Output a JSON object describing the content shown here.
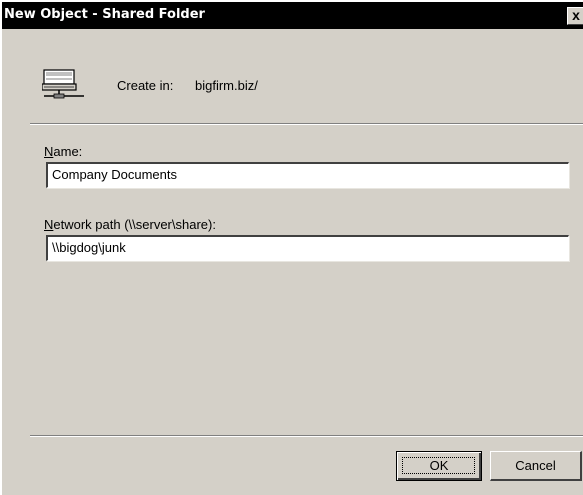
{
  "window": {
    "title": "New Object - Shared Folder",
    "close_label": "x"
  },
  "header": {
    "icon": "network-server-icon",
    "create_in_label": "Create in:",
    "create_in_value": "bigfirm.biz/"
  },
  "form": {
    "name_label_mnemonic": "N",
    "name_label_rest": "ame:",
    "name_value": "Company Documents",
    "path_label_mnemonic": "N",
    "path_label_rest": "etwork path (\\\\server\\share):",
    "path_value": "\\\\bigdog\\junk"
  },
  "buttons": {
    "ok_label": "OK",
    "cancel_label": "Cancel"
  }
}
